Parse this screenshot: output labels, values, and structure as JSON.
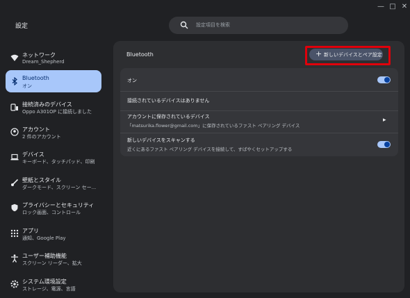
{
  "window": {
    "minimize": "—",
    "maximize": "□",
    "close": "✕"
  },
  "app_title": "設定",
  "search": {
    "placeholder": "設定項目を検索",
    "icon": "search-icon"
  },
  "sidebar": {
    "items": [
      {
        "label": "ネットワーク",
        "sub": "Dream_Shepherd",
        "icon": "wifi-icon",
        "active": false
      },
      {
        "label": "Bluetooth",
        "sub": "オン",
        "icon": "bluetooth-icon",
        "active": true
      },
      {
        "label": "接続済みのデバイス",
        "sub": "Oppo A301OP に接続しました",
        "icon": "phone-laptop-icon",
        "active": false
      },
      {
        "label": "アカウント",
        "sub": "2 件のアカウント",
        "icon": "account-icon",
        "active": false
      },
      {
        "label": "デバイス",
        "sub": "キーボード、タッチパッド、印刷",
        "icon": "laptop-icon",
        "active": false
      },
      {
        "label": "壁紙とスタイル",
        "sub": "ダークモード、スクリーン セー...",
        "icon": "paintbrush-icon",
        "active": false
      },
      {
        "label": "プライバシーとセキュリティ",
        "sub": "ロック画面、コントロール",
        "icon": "shield-icon",
        "active": false
      },
      {
        "label": "アプリ",
        "sub": "通知、Google Play",
        "icon": "apps-grid-icon",
        "active": false
      },
      {
        "label": "ユーザー補助機能",
        "sub": "スクリーン リーダー、拡大",
        "icon": "accessibility-icon",
        "active": false
      },
      {
        "label": "システム環境設定",
        "sub": "ストレージ、電源、言語",
        "icon": "system-gear-icon",
        "active": false
      }
    ]
  },
  "main": {
    "title": "Bluetooth",
    "pair_button": "新しいデバイスとペア設定",
    "highlight_color": "#e0000b",
    "rows": {
      "on_label": "オン",
      "on_toggle": true,
      "no_devices": "接続されているデバイスはありません",
      "saved_title": "アカウントに保存されているデバイス",
      "saved_sub": "「matsurika.flower@gmail.com」に保存されているファスト ペアリング デバイス",
      "scan_title": "新しいデバイスをスキャンする",
      "scan_sub": "近くにあるファスト ペアリング デバイスを接続して、すばやくセットアップする",
      "scan_toggle": true
    }
  },
  "colors": {
    "accent": "#a8c7fa",
    "background": "#202124",
    "panel": "#2d2e31"
  }
}
